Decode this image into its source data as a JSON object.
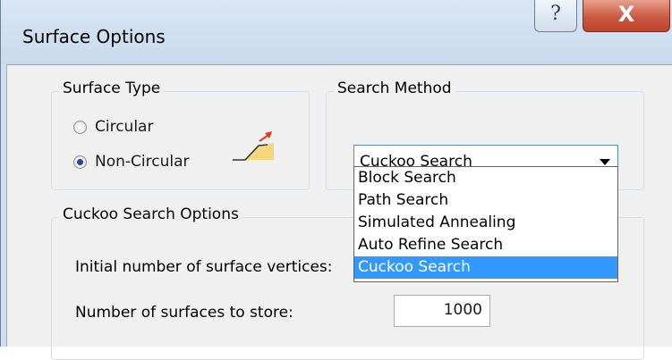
{
  "window": {
    "title": "Surface Options",
    "help_glyph": "?",
    "close_glyph": "X"
  },
  "surface_type": {
    "label": "Surface Type",
    "options": [
      {
        "label": "Circular",
        "checked": false
      },
      {
        "label": "Non-Circular",
        "checked": true
      }
    ],
    "icon": "non-circular-surface-icon"
  },
  "search_method": {
    "label": "Search Method",
    "selected": "Cuckoo Search",
    "options": [
      "Block Search",
      "Path Search",
      "Simulated Annealing",
      "Auto Refine Search",
      "Cuckoo Search"
    ],
    "highlighted_index": 4
  },
  "cuckoo_options": {
    "label": "Cuckoo Search Options",
    "fields": [
      {
        "label": "Initial number of surface vertices:"
      },
      {
        "label": "Number of surfaces to store:",
        "value": "1000"
      }
    ]
  },
  "colors": {
    "selection_highlight": "#3399ff",
    "close_button": "#c95a42",
    "icon_fill": "#f5d77a",
    "icon_arrow": "#e23a1d"
  }
}
